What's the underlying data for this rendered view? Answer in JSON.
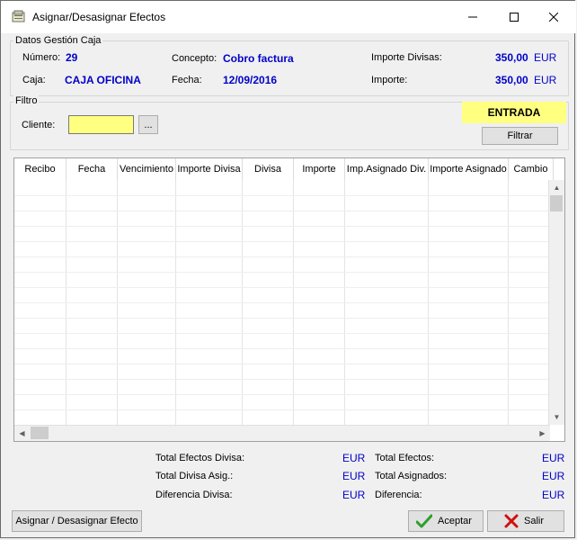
{
  "window": {
    "title": "Asignar/Desasignar Efectos"
  },
  "datos": {
    "legend": "Datos Gestión Caja",
    "numero_label": "Número:",
    "numero": "29",
    "concepto_label": "Concepto:",
    "concepto": "Cobro factura",
    "importe_divisas_label": "Importe Divisas:",
    "importe_divisas": "350,00",
    "importe_divisas_currency": "EUR",
    "caja_label": "Caja:",
    "caja": "CAJA OFICINA",
    "fecha_label": "Fecha:",
    "fecha": "12/09/2016",
    "importe_label": "Importe:",
    "importe": "350,00",
    "importe_currency": "EUR"
  },
  "filtro": {
    "legend": "Filtro",
    "cliente_label": "Cliente:",
    "cliente_value": "",
    "browse_label": "...",
    "status": "ENTRADA",
    "status_color": "#ffff80",
    "filtrar_label": "Filtrar"
  },
  "grid": {
    "columns": [
      "Recibo",
      "Fecha",
      "Vencimiento",
      "Importe Divisa",
      "Divisa",
      "Importe",
      "Imp.Asignado Div.",
      "Importe Asignado",
      "Cambio"
    ]
  },
  "totals": {
    "total_efectos_divisa_label": "Total Efectos Divisa:",
    "total_efectos_divisa": "EUR",
    "total_divisa_asig_label": "Total Divisa Asig.:",
    "total_divisa_asig": "EUR",
    "diferencia_divisa_label": "Diferencia Divisa:",
    "diferencia_divisa": "EUR",
    "total_efectos_label": "Total Efectos:",
    "total_efectos": "EUR",
    "total_asignados_label": "Total Asignados:",
    "total_asignados": "EUR",
    "diferencia_label": "Diferencia:",
    "diferencia": "EUR"
  },
  "buttons": {
    "asignar": "Asignar / Desasignar Efecto",
    "aceptar": "Aceptar",
    "salir": "Salir"
  },
  "colors": {
    "value_blue": "#0000c8",
    "highlight_yellow": "#ffff80",
    "accept_green": "#2e9e2e",
    "cancel_red": "#d01010"
  },
  "icons": [
    "app-icon",
    "minimize-icon",
    "maximize-icon",
    "close-icon",
    "checkmark-icon",
    "x-cross-icon"
  ]
}
